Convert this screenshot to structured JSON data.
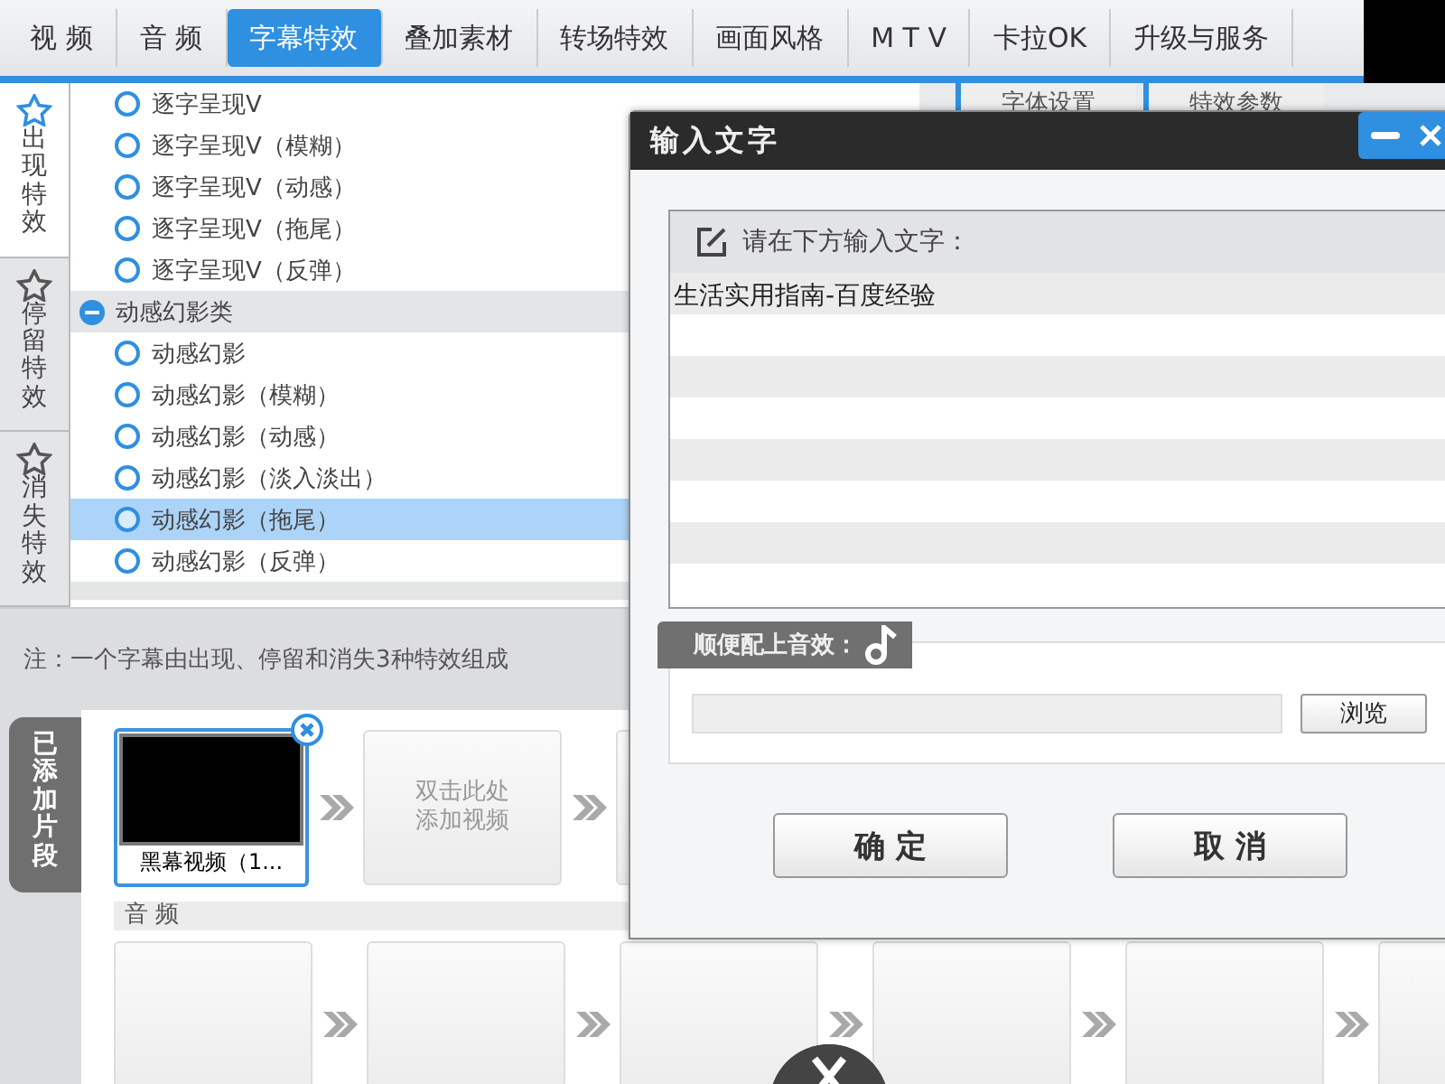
{
  "nav_tabs": [
    {
      "label": "视 频",
      "selected": false
    },
    {
      "label": "音 频",
      "selected": false
    },
    {
      "label": "字幕特效",
      "selected": true
    },
    {
      "label": "叠加素材",
      "selected": false
    },
    {
      "label": "转场特效",
      "selected": false
    },
    {
      "label": "画面风格",
      "selected": false
    },
    {
      "label": "M T V",
      "selected": false
    },
    {
      "label": "卡拉OK",
      "selected": false
    },
    {
      "label": "升级与服务",
      "selected": false
    }
  ],
  "effect_tabs": [
    {
      "label": "出现特效",
      "selected": true
    },
    {
      "label": "停留特效",
      "selected": false
    },
    {
      "label": "消失特效",
      "selected": false
    }
  ],
  "effect_list": [
    {
      "kind": "item",
      "label": "逐字呈现V",
      "selected": false
    },
    {
      "kind": "item",
      "label": "逐字呈现V（模糊）",
      "selected": false
    },
    {
      "kind": "item",
      "label": "逐字呈现V（动感）",
      "selected": false
    },
    {
      "kind": "item",
      "label": "逐字呈现V（拖尾）",
      "selected": false
    },
    {
      "kind": "item",
      "label": "逐字呈现V（反弹）",
      "selected": false
    },
    {
      "kind": "group",
      "label": "动感幻影类",
      "expanded": true
    },
    {
      "kind": "item",
      "label": "动感幻影",
      "selected": false
    },
    {
      "kind": "item",
      "label": "动感幻影（模糊）",
      "selected": false
    },
    {
      "kind": "item",
      "label": "动感幻影（动感）",
      "selected": false
    },
    {
      "kind": "item",
      "label": "动感幻影（淡入淡出）",
      "selected": false
    },
    {
      "kind": "item",
      "label": "动感幻影（拖尾）",
      "selected": true
    },
    {
      "kind": "item",
      "label": "动感幻影（反弹）",
      "selected": false
    }
  ],
  "settings_tabs": [
    {
      "label": "字体设置"
    },
    {
      "label": "特效参数"
    }
  ],
  "note": "注：一个字幕由出现、停留和消失3种特效组成",
  "clips": {
    "tab_label": "已添加片段",
    "video_slots": [
      {
        "kind": "clip",
        "label": "黑幕视频（1...",
        "selected": true
      },
      {
        "kind": "empty",
        "label": "双击此处添加视频"
      },
      {
        "kind": "blank"
      }
    ],
    "audio_label": "音 频"
  },
  "dialog": {
    "title": "输入文字",
    "prompt": "请在下方输入文字：",
    "value": "生活实用指南-百度经验",
    "sound_label": "顺便配上音效：",
    "browse": "浏览",
    "ok": "确 定",
    "cancel": "取 消"
  }
}
